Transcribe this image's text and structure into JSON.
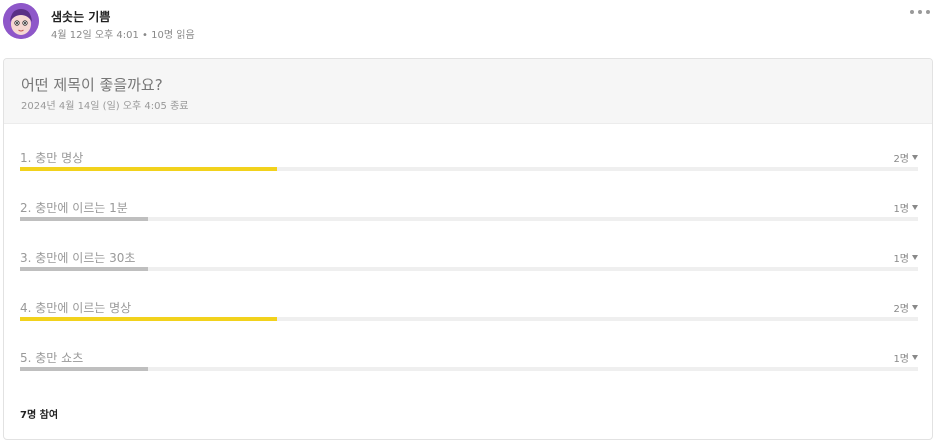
{
  "post": {
    "author": "샘솟는 기쁨",
    "meta": "4월 12일 오후 4:01 • 10명 읽음"
  },
  "poll": {
    "title": "어떤 제목이 좋을까요?",
    "end_text": "2024년 4월 14일 (일) 오후 4:05 종료",
    "total_voters": 7,
    "options": [
      {
        "label": "1. 충만 명상",
        "count": "2명",
        "votes": 2,
        "fraction": 0.2857,
        "highlight": true
      },
      {
        "label": "2. 충만에 이르는 1분",
        "count": "1명",
        "votes": 1,
        "fraction": 0.1429,
        "highlight": false
      },
      {
        "label": "3. 충만에 이르는 30초",
        "count": "1명",
        "votes": 1,
        "fraction": 0.1429,
        "highlight": false
      },
      {
        "label": "4. 충만에 이르는 명상",
        "count": "2명",
        "votes": 2,
        "fraction": 0.2857,
        "highlight": true
      },
      {
        "label": "5. 충만 쇼츠",
        "count": "1명",
        "votes": 1,
        "fraction": 0.1429,
        "highlight": false
      }
    ],
    "participants_label": "7명 참여"
  },
  "colors": {
    "leading_bar": "#f2d21c",
    "other_bar": "#bfbfbf",
    "avatar": "#8e57c9"
  },
  "icons": {
    "more": "more-options-icon",
    "caret": "caret-down-icon"
  }
}
